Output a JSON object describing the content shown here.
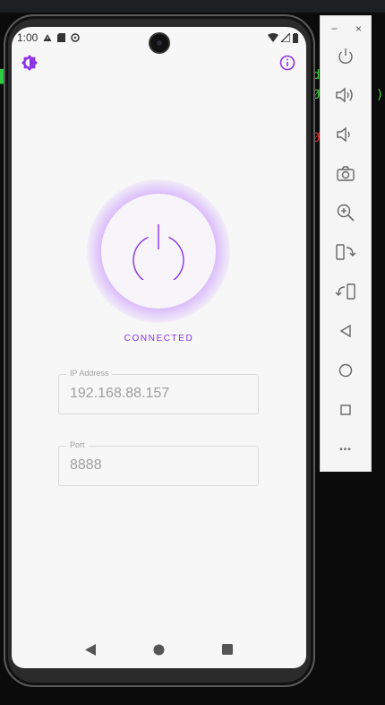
{
  "status_bar": {
    "time": "1:00"
  },
  "header": {
    "left_icon": "brightness-icon",
    "right_icon": "info-icon",
    "accent_color": "#8b32e6"
  },
  "power": {
    "icon": "power-icon",
    "state_label": "CONNECTED",
    "glow_color": "#b56eff"
  },
  "fields": {
    "ip": {
      "label": "IP Address",
      "value": "192.168.88.157"
    },
    "port": {
      "label": "Port",
      "value": "8888"
    }
  },
  "navbar": {
    "back_icon": "back-triangle-icon",
    "home_icon": "home-circle-icon",
    "recents_icon": "recents-square-icon"
  },
  "emulator_toolbar": {
    "minimize": "−",
    "close": "×",
    "more": "•••",
    "buttons": [
      "power-icon",
      "volume-up-icon",
      "volume-down-icon",
      "camera-icon",
      "zoom-icon",
      "rotate-left-icon",
      "rotate-right-icon",
      "back-icon",
      "home-icon",
      "overview-icon",
      "more-icon"
    ]
  }
}
